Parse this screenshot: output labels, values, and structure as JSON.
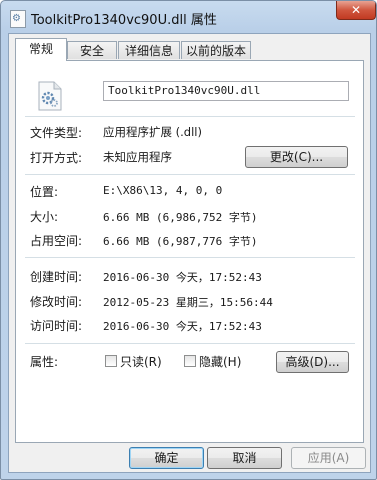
{
  "window": {
    "title": "ToolkitPro1340vc90U.dll 属性",
    "close_label": "✕"
  },
  "tabs": [
    {
      "label": "常规",
      "active": true
    },
    {
      "label": "安全",
      "active": false
    },
    {
      "label": "详细信息",
      "active": false
    },
    {
      "label": "以前的版本",
      "active": false
    }
  ],
  "general": {
    "filename": "ToolkitPro1340vc90U.dll",
    "file_type_label": "文件类型:",
    "file_type_value": "应用程序扩展 (.dll)",
    "open_with_label": "打开方式:",
    "open_with_value": "未知应用程序",
    "change_button": "更改(C)...",
    "location_label": "位置:",
    "location_value": "E:\\X86\\13, 4, 0, 0",
    "size_label": "大小:",
    "size_value": "6.66 MB (6,986,752 字节)",
    "size_on_disk_label": "占用空间:",
    "size_on_disk_value": "6.66 MB (6,987,776 字节)",
    "created_label": "创建时间:",
    "created_value": "2016-06-30 今天，17:52:43",
    "modified_label": "修改时间:",
    "modified_value": "2012-05-23 星期三，15:56:44",
    "accessed_label": "访问时间:",
    "accessed_value": "2016-06-30 今天，17:52:43",
    "attributes_label": "属性:",
    "readonly_label": "只读(R)",
    "readonly_checked": false,
    "hidden_label": "隐藏(H)",
    "hidden_checked": false,
    "advanced_button": "高级(D)..."
  },
  "footer": {
    "ok": "确定",
    "cancel": "取消",
    "apply": "应用(A)"
  }
}
